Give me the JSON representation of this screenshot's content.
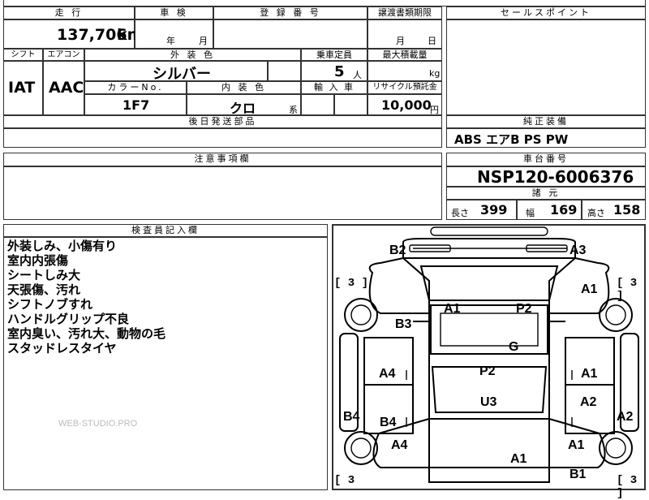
{
  "header": {
    "mileage_label": "走 行",
    "mileage_value": "137,706",
    "mileage_unit": "km",
    "inspection_label": "車 検",
    "inspection_year": "年",
    "inspection_month": "月",
    "registration_label": "登 録 番 号",
    "transfer_label": "譲渡書類期限",
    "transfer_month": "月",
    "transfer_day": "日",
    "sales_point_label": "セールスポイント"
  },
  "specs": {
    "shift_label": "シフト",
    "shift_value": "IAT",
    "aircon_label": "エアコン",
    "aircon_value": "AAC",
    "exterior_color_label": "外 装 色",
    "exterior_color_value": "シルバー",
    "capacity_label": "乗車定員",
    "capacity_value": "5",
    "capacity_unit": "人",
    "max_load_label": "最大積載量",
    "max_load_unit": "kg",
    "color_no_label": "カラーNo.",
    "color_no_value": "1F7",
    "interior_color_label": "内 装 色",
    "interior_color_value": "クロ",
    "interior_color_suffix": "系",
    "import_label": "輸 入 車",
    "recycle_label": "リサイクル預託金",
    "recycle_value": "10,000",
    "recycle_unit": "円",
    "later_parts_label": "後日発送部品"
  },
  "equipment": {
    "label": "純正装備",
    "value": "ABS エアB PS PW"
  },
  "notes": {
    "label": "注意事項欄"
  },
  "chassis": {
    "label": "車台番号",
    "value": "NSP120-6006376",
    "dims_label": "諸 元",
    "length_label": "長さ",
    "length_value": "399",
    "width_label": "幅",
    "width_value": "169",
    "height_label": "高さ",
    "height_value": "158"
  },
  "inspector": {
    "label": "検査員記入欄",
    "lines": [
      "外装しみ、小傷有り",
      "室内内張傷",
      "シートしみ大",
      "天張傷、汚れ",
      "シフトノブすれ",
      "ハンドルグリップ不良",
      "室内臭い、汚れ大、動物の毛",
      "スタッドレスタイヤ"
    ],
    "watermark": "WEB-STUDIO.PRO"
  },
  "diagram": {
    "tire_counts": [
      "[ 3 ]",
      "[ 3 ]",
      "[ 3",
      "[ 3 ]"
    ],
    "marks": [
      "B2",
      "A3",
      "A1",
      "A1",
      "P2",
      "B3",
      "G",
      "A4",
      "P2",
      "A1",
      "U3",
      "A2",
      "B4",
      "B4",
      "A2",
      "A4",
      "A1",
      "A1",
      "B1"
    ]
  }
}
